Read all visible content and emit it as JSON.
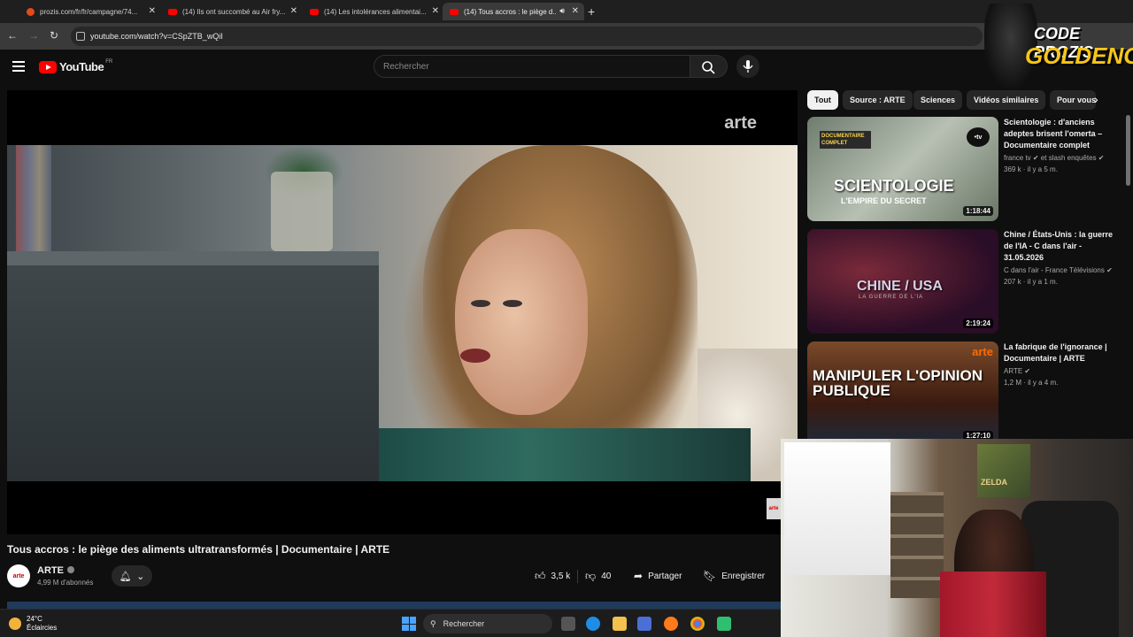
{
  "browser": {
    "tabs": [
      {
        "title": "prozis.com/fr/fr/campagne/74...",
        "kind": "prozis"
      },
      {
        "title": "(14) Ils ont succombé au Air fry...",
        "kind": "youtube"
      },
      {
        "title": "(14) Les intolérances alimentai...",
        "kind": "youtube"
      },
      {
        "title": "(14) Tous accros : le piège d...",
        "kind": "youtube",
        "active": true
      }
    ],
    "url": "youtube.com/watch?v=CSpZTB_wQiI"
  },
  "youtube": {
    "logo_text": "YouTube",
    "region": "FR",
    "search_placeholder": "Rechercher"
  },
  "player": {
    "watermark": "arte",
    "corner_badge": "arte"
  },
  "video": {
    "title": "Tous accros : le piège des aliments ultratransformés | Documentaire | ARTE",
    "channel": "ARTE",
    "channel_avatar_text": "arte",
    "subscribers": "4,99 M d'abonnés",
    "likes": "3,5 k",
    "dislikes": "40",
    "share_label": "Partager",
    "save_label": "Enregistrer"
  },
  "chips": [
    "Tout",
    "Source : ARTE",
    "Sciences",
    "Vidéos similaires",
    "Pour vous"
  ],
  "recommendations": [
    {
      "title": "Scientologie : d'anciens adeptes brisent l'omerta – Documentaire complet",
      "channel": "france tv ✔ et slash enquêtes ✔",
      "meta": "369 k · il y a 5 m.",
      "duration": "1:18:44",
      "thumb_title": "SCIENTOLOGIE",
      "thumb_sub": "L'EMPIRE DU SECRET",
      "thumb_badge": "DOCUMENTAIRE COMPLET",
      "thumb_logo": "•tv"
    },
    {
      "title": "Chine / États-Unis : la guerre de l'IA - C dans l'air - 31.05.2026",
      "channel": "C dans l'air - France Télévisions ✔",
      "meta": "207 k · il y a 1 m.",
      "duration": "2:19:24",
      "thumb_title": "CHINE / USA",
      "thumb_sub": "LA GUERRE DE L'IA"
    },
    {
      "title": "La fabrique de l'ignorance | Documentaire | ARTE",
      "channel": "ARTE ✔",
      "meta": "1,2 M · il y a 4 m.",
      "duration": "1:27:10",
      "thumb_title": "MANIPULER L'OPINION PUBLIQUE",
      "thumb_logo": "arte"
    }
  ],
  "overlay": {
    "brand_line1": "CODE PROZIS",
    "brand_line2": "GOLDENG",
    "poster_text": "ZELDA"
  },
  "taskbar": {
    "temperature": "24°C",
    "weather": "Éclaircies",
    "search": "Rechercher"
  },
  "colors": {
    "accent": "#ff0000",
    "background": "#0f0f0f",
    "chip_active": "#f1f1f1",
    "brand_gold": "#f5c51a"
  }
}
